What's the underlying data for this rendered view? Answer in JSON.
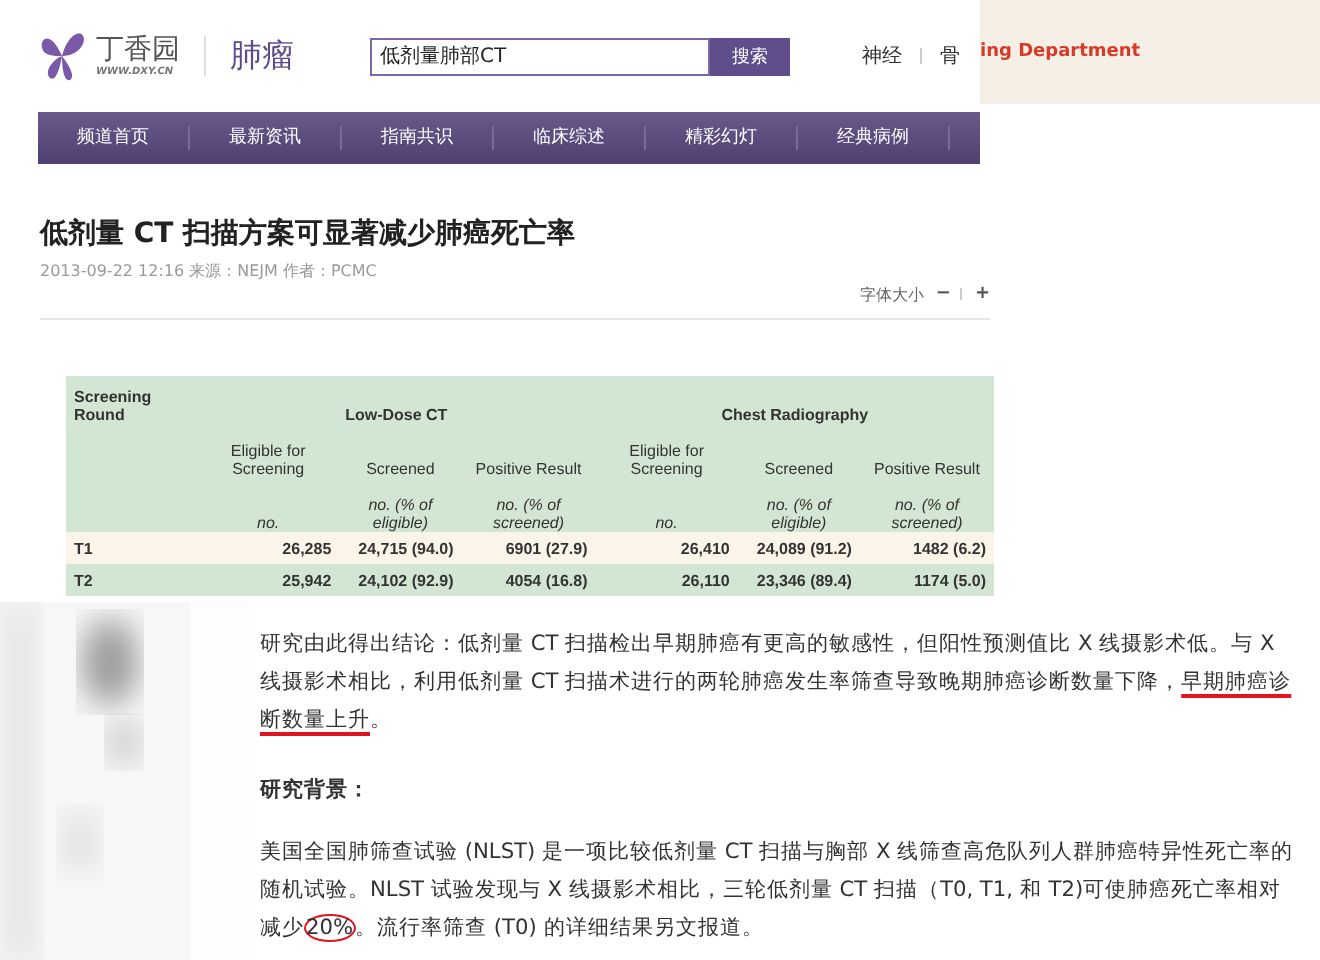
{
  "header": {
    "logo_name": "丁香园",
    "logo_url": "WWW.DXY.CN",
    "channel": "肺瘤",
    "search": {
      "value": "低剂量肺部CT"
    },
    "search_button": "搜索",
    "links": [
      "神经",
      "骨"
    ],
    "banner_text": "ing Department"
  },
  "nav": [
    {
      "label": "频道首页"
    },
    {
      "label": "最新资讯"
    },
    {
      "label": "指南共识"
    },
    {
      "label": "临床综述"
    },
    {
      "label": "精彩幻灯"
    },
    {
      "label": "经典病例"
    }
  ],
  "article": {
    "title": "低剂量 CT 扫描方案可显著减少肺癌死亡率",
    "meta": "2013-09-22 12:16   来源：NEJM   作者：PCMC",
    "font_size_label": "字体大小",
    "font_minus": "−",
    "font_plus": "+"
  },
  "table": {
    "first_heading": "Screening Round",
    "groups": [
      "Low-Dose CT",
      "Chest Radiography"
    ],
    "columns": [
      {
        "label": "Eligible for Screening",
        "unit": "no."
      },
      {
        "label": "Screened",
        "unit": "no. (% of eligible)"
      },
      {
        "label": "Positive Result",
        "unit": "no. (% of screened)"
      },
      {
        "label": "Eligible for Screening",
        "unit": "no."
      },
      {
        "label": "Screened",
        "unit": "no. (% of eligible)"
      },
      {
        "label": "Positive Result",
        "unit": "no. (% of screened)"
      }
    ],
    "rows": [
      {
        "round": "T1",
        "cells": [
          "26,285",
          "24,715 (94.0)",
          "6901 (27.9)",
          "26,410",
          "24,089 (91.2)",
          "1482 (6.2)"
        ]
      },
      {
        "round": "T2",
        "cells": [
          "25,942",
          "24,102 (92.9)",
          "4054 (16.8)",
          "26,110",
          "23,346 (89.4)",
          "1174 (5.0)"
        ]
      }
    ]
  },
  "body": [
    {
      "kind": "paragraph",
      "segments": [
        {
          "text": "研究由此得出结论：低剂量 CT 扫描检出早期肺癌有更高的敏感性，但阳性预测值比 X 线摄影术低。与 X 线摄影术相比，利用低剂量 CT 扫描术进行的两轮肺癌发生率筛查导致晚期肺癌诊断数量下降，",
          "underlined": false,
          "circled": false
        },
        {
          "text": "早期肺癌诊断数量上升",
          "underlined": true,
          "circled": false
        },
        {
          "text": "。",
          "underlined": false,
          "circled": false
        }
      ]
    },
    {
      "kind": "heading",
      "segments": [
        {
          "text": "研究背景：",
          "underlined": false,
          "circled": false
        }
      ]
    },
    {
      "kind": "paragraph",
      "segments": [
        {
          "text": "美国全国肺筛查试验 (NLST) 是一项比较低剂量 CT 扫描与胸部 X 线筛查高危队列人群肺癌特异性死亡率的随机试验。NLST 试验发现与 X 线摄影术相比，三轮低剂量 CT 扫描（T0, T1, 和 T2)可使肺癌死亡率相对减少",
          "underlined": false,
          "circled": false
        },
        {
          "text": "20%",
          "underlined": false,
          "circled": true
        },
        {
          "text": "。流行率筛查 (T0) 的详细结果另文报道。",
          "underlined": false,
          "circled": false
        }
      ]
    }
  ]
}
